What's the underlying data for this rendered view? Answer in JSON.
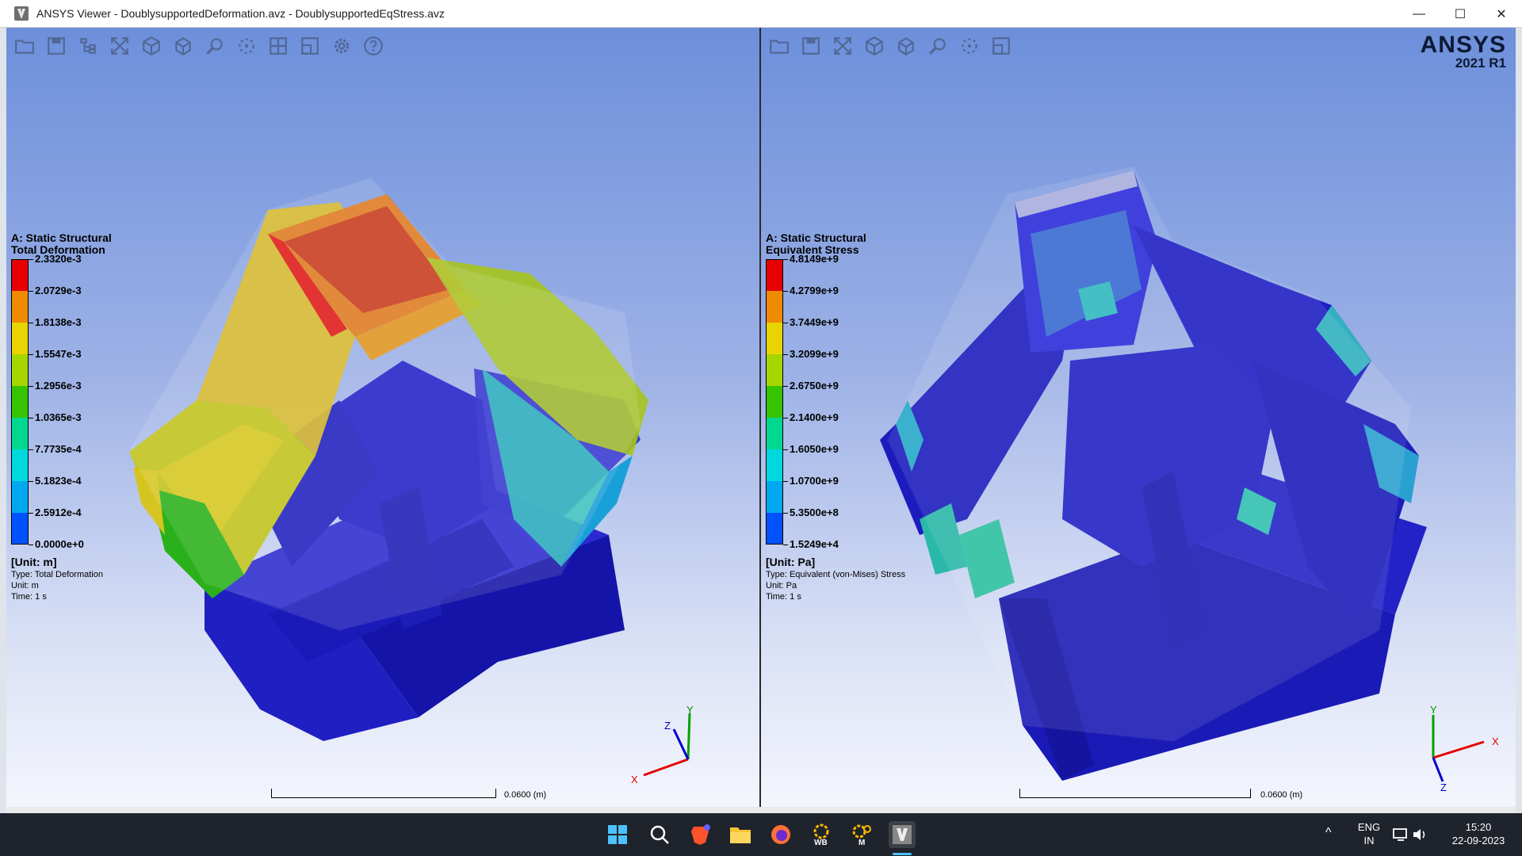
{
  "window": {
    "title": "ANSYS Viewer - DoublysupportedDeformation.avz - DoublysupportedEqStress.avz",
    "minimize": "—",
    "maximize": "☐",
    "close": "✕"
  },
  "left_view": {
    "toolbar": [
      "open-icon",
      "save-icon",
      "tree-icon",
      "fit-icon",
      "iso-view-icon",
      "box-view-icon",
      "zoom-box-icon",
      "rotate-icon",
      "grid-view-icon",
      "window-icon",
      "settings-icon",
      "help-icon"
    ],
    "legend": {
      "analysis": "A: Static Structural",
      "result": "Total Deformation",
      "values": [
        "2.3320e-3",
        "2.0729e-3",
        "1.8138e-3",
        "1.5547e-3",
        "1.2956e-3",
        "1.0365e-3",
        "7.7735e-4",
        "5.1823e-4",
        "2.5912e-4",
        "0.0000e+0"
      ],
      "unit": "[Unit: m]",
      "type": "Type: Total Deformation",
      "unit_line": "Unit: m",
      "time": "Time: 1 s"
    },
    "scale_label": "0.0600",
    "scale_unit": "(m)",
    "triad": {
      "x": "X",
      "y": "Y",
      "z": "Z"
    }
  },
  "right_view": {
    "toolbar": [
      "open-icon",
      "save-icon",
      "fit-icon",
      "iso-view-icon",
      "box-view-icon",
      "zoom-box-icon",
      "rotate-icon",
      "window-icon"
    ],
    "legend": {
      "analysis": "A: Static Structural",
      "result": "Equivalent Stress",
      "values": [
        "4.8149e+9",
        "4.2799e+9",
        "3.7449e+9",
        "3.2099e+9",
        "2.6750e+9",
        "2.1400e+9",
        "1.6050e+9",
        "1.0700e+9",
        "5.3500e+8",
        "1.5249e+4"
      ],
      "unit": "[Unit: Pa]",
      "type": "Type: Equivalent (von-Mises) Stress",
      "unit_line": "Unit: Pa",
      "time": "Time: 1 s"
    },
    "scale_label": "0.0600",
    "scale_unit": "(m)",
    "triad": {
      "x": "X",
      "y": "Y",
      "z": "Z"
    },
    "brand": {
      "name": "ANSYS",
      "version": "2021 R1"
    }
  },
  "legend_colors": [
    "#e60000",
    "#f08a00",
    "#e8d400",
    "#a6d600",
    "#36c400",
    "#00d890",
    "#00d8e0",
    "#00a8f0",
    "#0052ff",
    "#0000c8"
  ],
  "taskbar": {
    "apps": [
      "windows-start-icon",
      "search-icon",
      "brave-icon",
      "file-explorer-icon",
      "firefox-icon",
      "workbench-icon",
      "mechanical-icon",
      "ansys-viewer-icon"
    ],
    "wb_label": "WB",
    "m_label": "M",
    "language": "ENG",
    "region": "IN",
    "time": "15:20",
    "date": "22-09-2023"
  }
}
